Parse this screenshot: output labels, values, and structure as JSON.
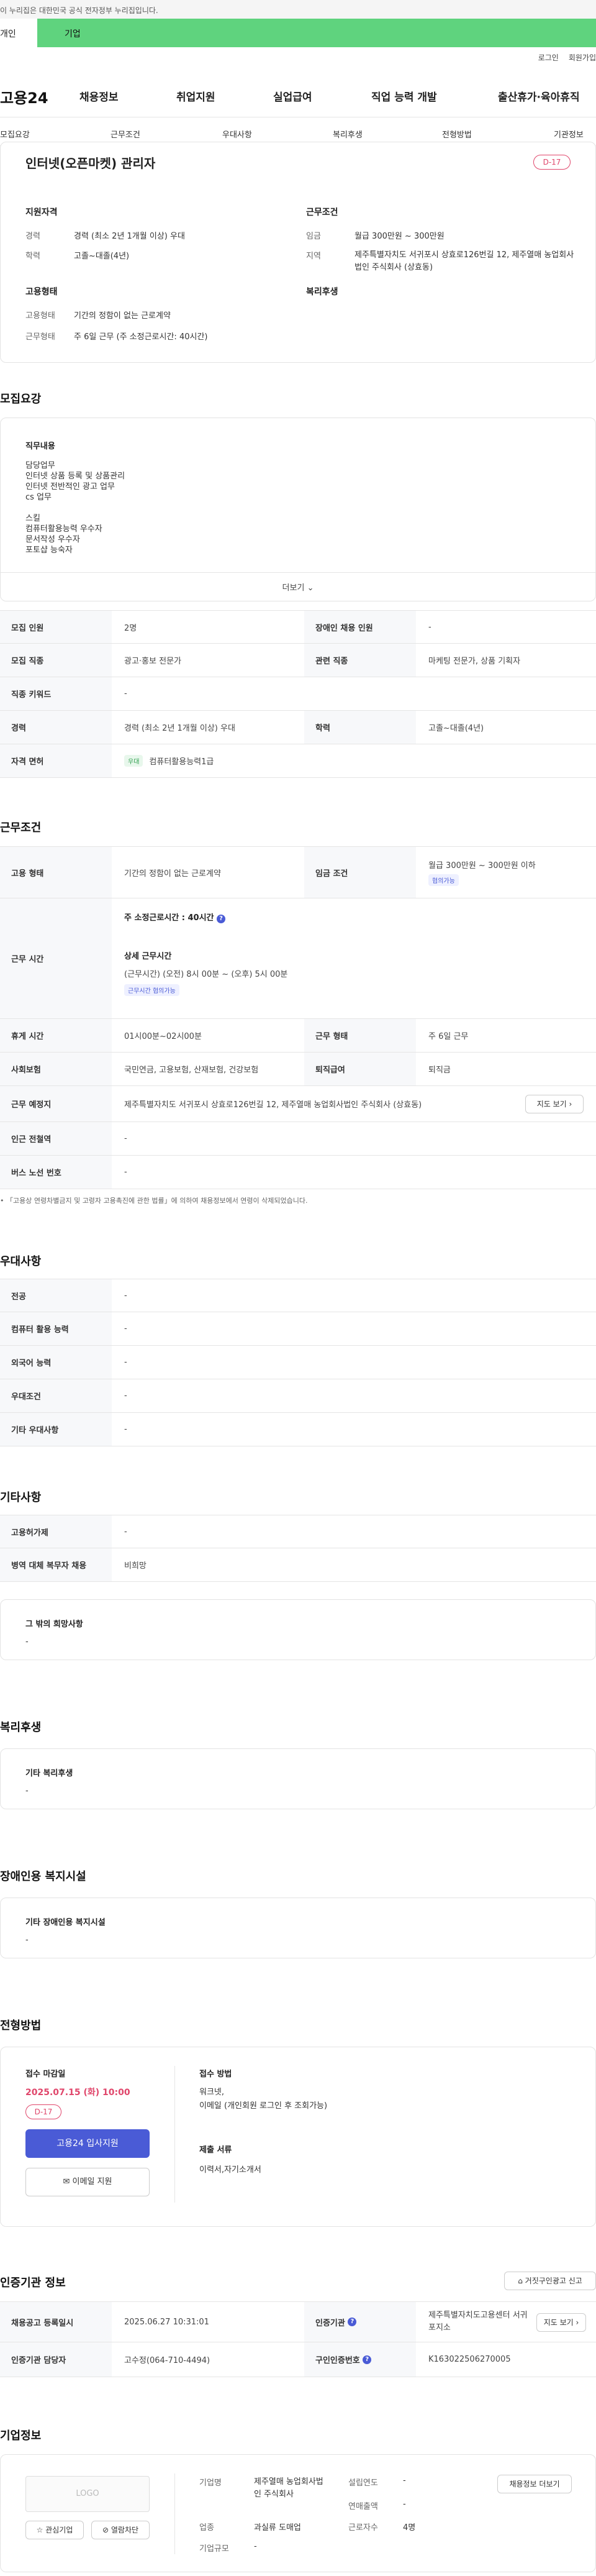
{
  "gov_banner": "이 누리집은 대한민국 공식 전자정부 누리집입니다.",
  "top_tabs": {
    "personal": "개인",
    "corporate": "기업"
  },
  "util": {
    "login": "로그인",
    "signup": "회원가입"
  },
  "logo": "고용24",
  "gnb": [
    "채용정보",
    "취업지원",
    "실업급여",
    "직업 능력 개발",
    "출산휴가·육아휴직"
  ],
  "subnav": [
    "모집요강",
    "근무조건",
    "우대사항",
    "복리후생",
    "전형방법",
    "기관정보"
  ],
  "job": {
    "title": "인터넷(오픈마켓) 관리자",
    "dday": "D-17",
    "qualification_title": "지원자격",
    "condition_title": "근무조건",
    "welfare_title": "복리후생",
    "employment_title": "고용형태",
    "career_label": "경력",
    "career_value": "경력 (최소 2년 1개월 이상) 우대",
    "edu_label": "학력",
    "edu_value": "고졸~대졸(4년)",
    "wage_label": "임금",
    "wage_value": "월급 300만원 ~ 300만원",
    "area_label": "지역",
    "area_value": "제주특별자치도 서귀포시 상효로126번길 12, 제주열매 농업회사법인 주식회사 (상효동)",
    "emp_label": "고용형태",
    "emp_value": "기간의 정함이 없는 근로계약",
    "worktype_label": "근무형태",
    "worktype_value": "주 6일 근무 (주 소정근로시간: 40시간)"
  },
  "recruit": {
    "heading": "모집요강",
    "duty_title": "직무내용",
    "duty_lines": [
      "담당업무",
      "인터넷 상품 등록 및 상품관리",
      "인터넷  전반적인 광고 업무",
      "cs 업무",
      "",
      "스킬",
      "컴퓨터활용능력 우수자",
      "문서작성 우수자",
      "포토샵 능숙자"
    ],
    "more": "더보기",
    "rows": {
      "headcount_label": "모집 인원",
      "headcount": "2명",
      "disabled_label": "장애인 채용 인원",
      "disabled": "-",
      "occupation_label": "모집 직종",
      "occupation": "광고·홍보 전문가",
      "related_label": "관련 직종",
      "related": "마케팅 전문가, 상품 기획자",
      "keyword_label": "직종 키워드",
      "keyword": "-",
      "career_label": "경력",
      "career": "경력 (최소 2년 1개월 이상) 우대",
      "edu_label": "학력",
      "edu": "고졸~대졸(4년)",
      "license_label": "자격 면허",
      "license_tag": "우대",
      "license": "컴퓨터활용능력1급"
    }
  },
  "conditions": {
    "heading": "근무조건",
    "emp_label": "고용 형태",
    "emp": "기간의 정함이 없는 근로계약",
    "wage_label": "임금 조건",
    "wage": "월급 300만원 ~ 300만원 이하",
    "wage_tag": "협의가능",
    "hours_label": "근무 시간",
    "hours_total": "주 소정근로시간 : 40시간",
    "hours_detail_title": "상세 근무시간",
    "hours_detail": "(근무시간) (오전) 8시 00분 ~ (오후) 5시 00분",
    "hours_tag": "근무시간 협의가능",
    "break_label": "휴게 시간",
    "break": "01시00분~02시00분",
    "worktype_label": "근무 형태",
    "worktype": "주 6일 근무",
    "insurance_label": "사회보험",
    "insurance": "국민연금, 고용보험, 산재보험, 건강보험",
    "severance_label": "퇴직급여",
    "severance": "퇴직금",
    "address_label": "근무 예정지",
    "address": "제주특별자치도 서귀포시 상효로126번길 12, 제주열매 농업회사법인 주식회사 (상효동)",
    "map_button": "지도 보기",
    "subway_label": "인근 전철역",
    "subway": "-",
    "bus_label": "버스 노선 번호",
    "bus": "-",
    "note": "「고용상 연령차별금지 및 고령자 고용촉진에 관한 법률」에 의하여 채용정보에서 연령이 삭제되었습니다."
  },
  "preference": {
    "heading": "우대사항",
    "rows": [
      {
        "label": "전공",
        "value": "-"
      },
      {
        "label": "컴퓨터 활용 능력",
        "value": "-"
      },
      {
        "label": "외국어 능력",
        "value": "-"
      },
      {
        "label": "우대조건",
        "value": "-"
      },
      {
        "label": "기타 우대사항",
        "value": "-"
      }
    ]
  },
  "etc": {
    "heading": "기타사항",
    "rows": [
      {
        "label": "고용허가제",
        "value": "-"
      },
      {
        "label": "병역 대체 복무자 채용",
        "value": "비희망"
      }
    ],
    "box_title": "그 밖의 희망사항",
    "box_value": "-"
  },
  "welfare": {
    "heading": "복리후생",
    "box_title": "기타 복리후생",
    "box_value": "-"
  },
  "disabled": {
    "heading": "장애인용 복지시설",
    "box_title": "기타 장애인용 복지시설",
    "box_value": "-"
  },
  "process": {
    "heading": "전형방법",
    "deadline_label": "접수 마감일",
    "deadline": "2025.07.15 (화) 10:00",
    "dday": "D-17",
    "apply_button": "고용24 입사지원",
    "email_button": "이메일 지원",
    "method_label": "접수 방법",
    "method": "워크넷,\n이메일 (개인회원 로그인 후 조회가능)",
    "docs_label": "제출 서류",
    "docs": "이력서,자기소개서"
  },
  "agency": {
    "heading": "인증기관 정보",
    "report_button": "거짓구인광고 신고",
    "reg_label": "채용공고 등록일시",
    "reg": "2025.06.27 10:31:01",
    "org_label": "인증기관",
    "org": "제주특별자치도고용센터 서귀포지소",
    "map_button": "지도 보기",
    "manager_label": "인증기관 담당자",
    "manager": "고수정(064-710-4494)",
    "notice_label": "구인인증번호",
    "notice": "K163022506270005"
  },
  "company": {
    "heading": "기업정보",
    "logo": "LOGO",
    "fav_button": "관심기업",
    "block_button": "열람차단",
    "name_label": "기업명",
    "name": "제주열매 농업회사법인 주식회사",
    "industry_label": "업종",
    "industry": "과실류 도매업",
    "size_label": "기업규모",
    "size": "-",
    "founded_label": "설립연도",
    "founded": "-",
    "sales_label": "연매출액",
    "sales": "-",
    "employees_label": "근로자수",
    "employees": "4명",
    "jobs_button": "채용정보 더보기"
  }
}
